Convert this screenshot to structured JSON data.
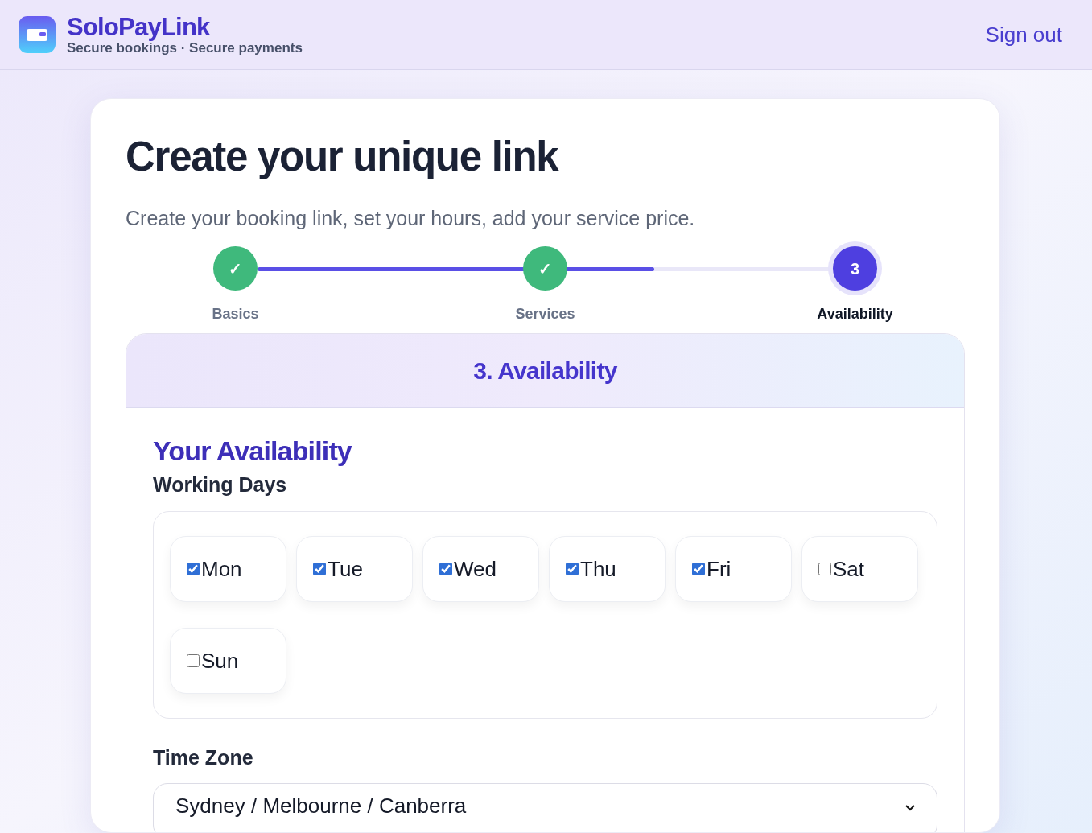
{
  "header": {
    "brand": "SoloPayLink",
    "tagline": "Secure bookings · Secure payments",
    "sign_out": "Sign out"
  },
  "card": {
    "title": "Create your unique link",
    "subtitle": "Create your booking link, set your hours, add your service price."
  },
  "stepper": {
    "level": 0.69,
    "steps": [
      {
        "label": "Basics",
        "marker": "✓",
        "kind": "done"
      },
      {
        "label": "Services",
        "marker": "✓",
        "kind": "done"
      },
      {
        "label": "Availability",
        "marker": "3",
        "kind": "current"
      }
    ]
  },
  "panel": {
    "title": "3. Availability",
    "heading": "Your Availability",
    "working_days_label": "Working Days",
    "days": [
      {
        "label": "Mon",
        "checked": true
      },
      {
        "label": "Tue",
        "checked": true
      },
      {
        "label": "Wed",
        "checked": true
      },
      {
        "label": "Thu",
        "checked": true
      },
      {
        "label": "Fri",
        "checked": true
      },
      {
        "label": "Sat",
        "checked": false
      },
      {
        "label": "Sun",
        "checked": false
      }
    ],
    "time_zone_label": "Time Zone",
    "time_zone_value": "Sydney / Melbourne / Canberra"
  }
}
